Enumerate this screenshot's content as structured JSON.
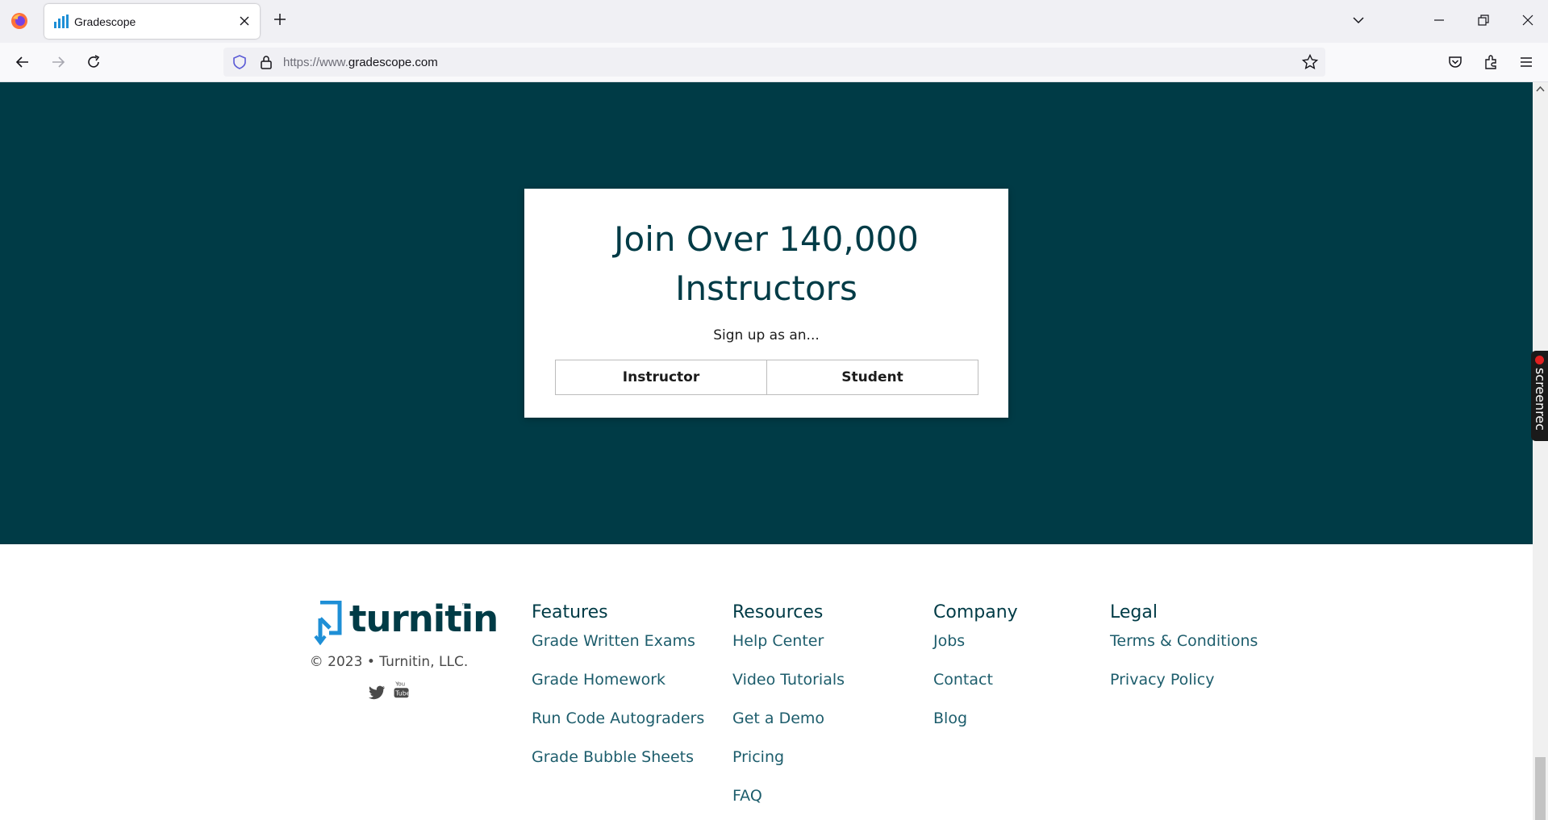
{
  "browser": {
    "tab_title": "Gradescope",
    "url_prefix": "https://www.",
    "url_domain": "gradescope.com",
    "icons": [
      "firefox-logo",
      "gradescope-bars-icon",
      "close-icon",
      "plus-icon",
      "chevron-down-icon",
      "minimize-icon",
      "restore-icon",
      "close-window-icon",
      "back-arrow-icon",
      "forward-arrow-icon",
      "reload-icon",
      "shield-icon",
      "lock-icon",
      "star-icon",
      "pocket-icon",
      "extensions-icon",
      "hamburger-menu-icon"
    ]
  },
  "hero": {
    "title_line1": "Join Over 140,000",
    "title_line2": "Instructors",
    "subtitle": "Sign up as an...",
    "buttons": {
      "instructor": "Instructor",
      "student": "Student"
    },
    "bg_color": "#003b46"
  },
  "overlay": {
    "screenrec_label": "screenrec"
  },
  "footer": {
    "brand_name": "turnitin",
    "brand_tm": "™",
    "copyright": "© 2023 • Turnitin, LLC.",
    "social_icons": [
      "twitter-icon",
      "youtube-icon"
    ],
    "columns": [
      {
        "heading": "Features",
        "links": [
          "Grade Written Exams",
          "Grade Homework",
          "Run Code Autograders",
          "Grade Bubble Sheets"
        ]
      },
      {
        "heading": "Resources",
        "links": [
          "Help Center",
          "Video Tutorials",
          "Get a Demo",
          "Pricing",
          "FAQ"
        ]
      },
      {
        "heading": "Company",
        "links": [
          "Jobs",
          "Contact",
          "Blog"
        ]
      },
      {
        "heading": "Legal",
        "links": [
          "Terms & Conditions",
          "Privacy Policy"
        ]
      }
    ],
    "link_color": "#1d5d6c",
    "heading_color": "#003b46"
  }
}
